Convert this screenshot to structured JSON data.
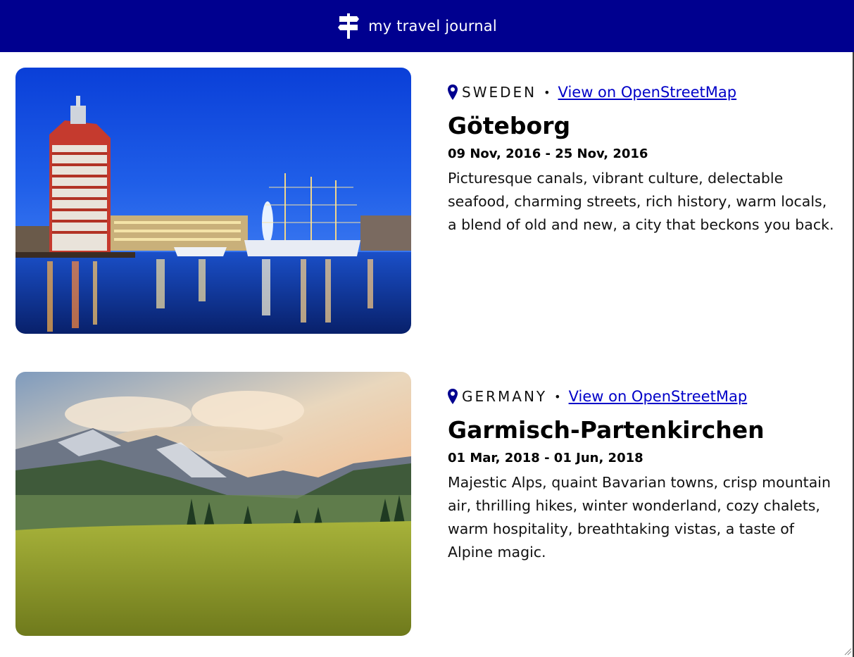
{
  "header": {
    "title": "my travel journal",
    "icon": "signpost-icon",
    "background": "#00008f"
  },
  "entries": [
    {
      "country": "SWEDEN",
      "separator": "•",
      "map_link": "View on OpenStreetMap",
      "place": "Göteborg",
      "dates": "09 Nov, 2016 - 25 Nov, 2016",
      "description": "Picturesque canals, vibrant culture, delectable seafood, charming streets, rich history, warm locals, a blend of old and new, a city that beckons you back."
    },
    {
      "country": "GERMANY",
      "separator": "•",
      "map_link": "View on OpenStreetMap",
      "place": "Garmisch-Partenkirchen",
      "dates": "01 Mar, 2018 - 01 Jun, 2018",
      "description": "Majestic Alps, quaint Bavarian towns, crisp mountain air, thrilling hikes, winter wonderland, cozy chalets, warm hospitality, breathtaking vistas, a taste of Alpine magic."
    }
  ],
  "colors": {
    "link": "#0000c8",
    "pin": "#00008f"
  }
}
